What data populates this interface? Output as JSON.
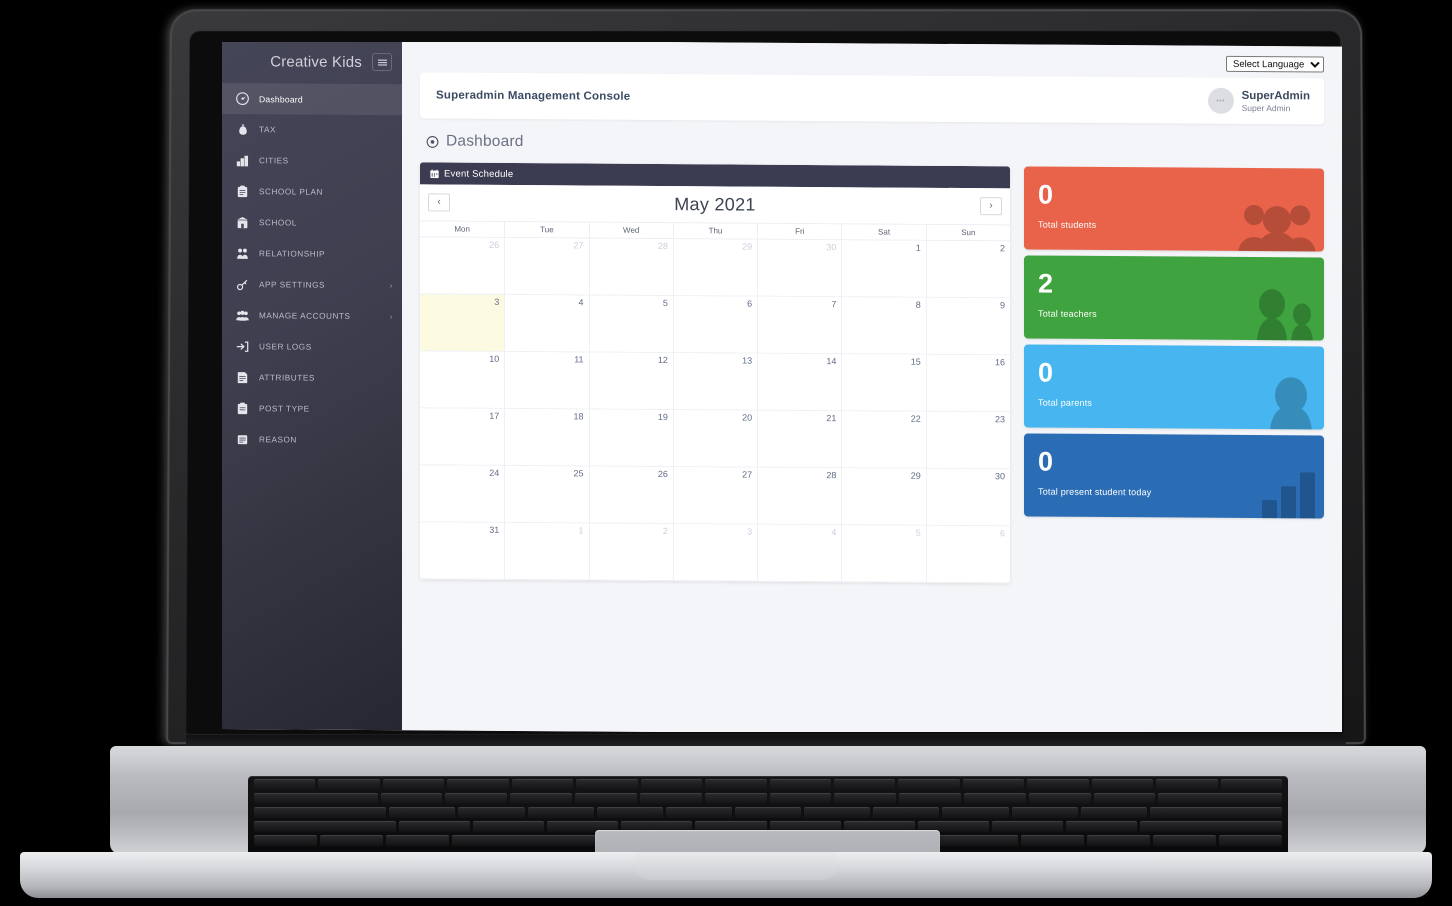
{
  "sidebar": {
    "brand": "Creative Kids",
    "toggle_icon": "hamburger-icon",
    "items": [
      {
        "label": "Dashboard",
        "icon": "speedometer-icon",
        "active": true,
        "caret": ""
      },
      {
        "label": "TAX",
        "icon": "money-bag-icon",
        "active": false,
        "caret": ""
      },
      {
        "label": "CITIES",
        "icon": "city-icon",
        "active": false,
        "caret": ""
      },
      {
        "label": "SCHOOL PLAN",
        "icon": "clipboard-icon",
        "active": false,
        "caret": ""
      },
      {
        "label": "SCHOOL",
        "icon": "school-icon",
        "active": false,
        "caret": ""
      },
      {
        "label": "RELATIONSHIP",
        "icon": "relationship-icon",
        "active": false,
        "caret": ""
      },
      {
        "label": "APP SETTINGS",
        "icon": "settings-icon",
        "active": false,
        "caret": "›"
      },
      {
        "label": "MANAGE ACCOUNTS",
        "icon": "users-icon",
        "active": false,
        "caret": "›"
      },
      {
        "label": "USER LOGS",
        "icon": "login-icon",
        "active": false,
        "caret": ""
      },
      {
        "label": "ATTRIBUTES",
        "icon": "attributes-icon",
        "active": false,
        "caret": ""
      },
      {
        "label": "POST TYPE",
        "icon": "post-icon",
        "active": false,
        "caret": ""
      },
      {
        "label": "REASON",
        "icon": "reason-icon",
        "active": false,
        "caret": ""
      }
    ]
  },
  "language": {
    "selected": "Select Language",
    "options": [
      "Select Language"
    ]
  },
  "topbar": {
    "console_title": "Superadmin Management Console",
    "user_name": "SuperAdmin",
    "user_role": "Super Admin",
    "avatar_initials": "•••"
  },
  "page": {
    "title": "Dashboard",
    "title_icon": "target-icon"
  },
  "calendar": {
    "card_title": "Event Schedule",
    "card_icon": "calendar-icon",
    "prev_label": "‹",
    "next_label": "›",
    "month_label": "May 2021",
    "dow": [
      "Mon",
      "Tue",
      "Wed",
      "Thu",
      "Fri",
      "Sat",
      "Sun"
    ],
    "weeks": [
      [
        {
          "d": "26",
          "other": true,
          "today": false
        },
        {
          "d": "27",
          "other": true,
          "today": false
        },
        {
          "d": "28",
          "other": true,
          "today": false
        },
        {
          "d": "29",
          "other": true,
          "today": false
        },
        {
          "d": "30",
          "other": true,
          "today": false
        },
        {
          "d": "1",
          "other": false,
          "today": false
        },
        {
          "d": "2",
          "other": false,
          "today": false
        }
      ],
      [
        {
          "d": "3",
          "other": false,
          "today": true
        },
        {
          "d": "4",
          "other": false,
          "today": false
        },
        {
          "d": "5",
          "other": false,
          "today": false
        },
        {
          "d": "6",
          "other": false,
          "today": false
        },
        {
          "d": "7",
          "other": false,
          "today": false
        },
        {
          "d": "8",
          "other": false,
          "today": false
        },
        {
          "d": "9",
          "other": false,
          "today": false
        }
      ],
      [
        {
          "d": "10",
          "other": false,
          "today": false
        },
        {
          "d": "11",
          "other": false,
          "today": false
        },
        {
          "d": "12",
          "other": false,
          "today": false
        },
        {
          "d": "13",
          "other": false,
          "today": false
        },
        {
          "d": "14",
          "other": false,
          "today": false
        },
        {
          "d": "15",
          "other": false,
          "today": false
        },
        {
          "d": "16",
          "other": false,
          "today": false
        }
      ],
      [
        {
          "d": "17",
          "other": false,
          "today": false
        },
        {
          "d": "18",
          "other": false,
          "today": false
        },
        {
          "d": "19",
          "other": false,
          "today": false
        },
        {
          "d": "20",
          "other": false,
          "today": false
        },
        {
          "d": "21",
          "other": false,
          "today": false
        },
        {
          "d": "22",
          "other": false,
          "today": false
        },
        {
          "d": "23",
          "other": false,
          "today": false
        }
      ],
      [
        {
          "d": "24",
          "other": false,
          "today": false
        },
        {
          "d": "25",
          "other": false,
          "today": false
        },
        {
          "d": "26",
          "other": false,
          "today": false
        },
        {
          "d": "27",
          "other": false,
          "today": false
        },
        {
          "d": "28",
          "other": false,
          "today": false
        },
        {
          "d": "29",
          "other": false,
          "today": false
        },
        {
          "d": "30",
          "other": false,
          "today": false
        }
      ],
      [
        {
          "d": "31",
          "other": false,
          "today": false
        },
        {
          "d": "1",
          "other": true,
          "today": false
        },
        {
          "d": "2",
          "other": true,
          "today": false
        },
        {
          "d": "3",
          "other": true,
          "today": false
        },
        {
          "d": "4",
          "other": true,
          "today": false
        },
        {
          "d": "5",
          "other": true,
          "today": false
        },
        {
          "d": "6",
          "other": true,
          "today": false
        }
      ]
    ]
  },
  "stats": [
    {
      "value": "0",
      "label": "Total students",
      "color": "#e8634a",
      "art": "students-icon"
    },
    {
      "value": "2",
      "label": "Total teachers",
      "color": "#3fa33f",
      "art": "teachers-icon"
    },
    {
      "value": "0",
      "label": "Total parents",
      "color": "#47b5ef",
      "art": "parent-icon"
    },
    {
      "value": "0",
      "label": "Total present student today",
      "color": "#2a6db5",
      "art": "bars-icon"
    }
  ]
}
